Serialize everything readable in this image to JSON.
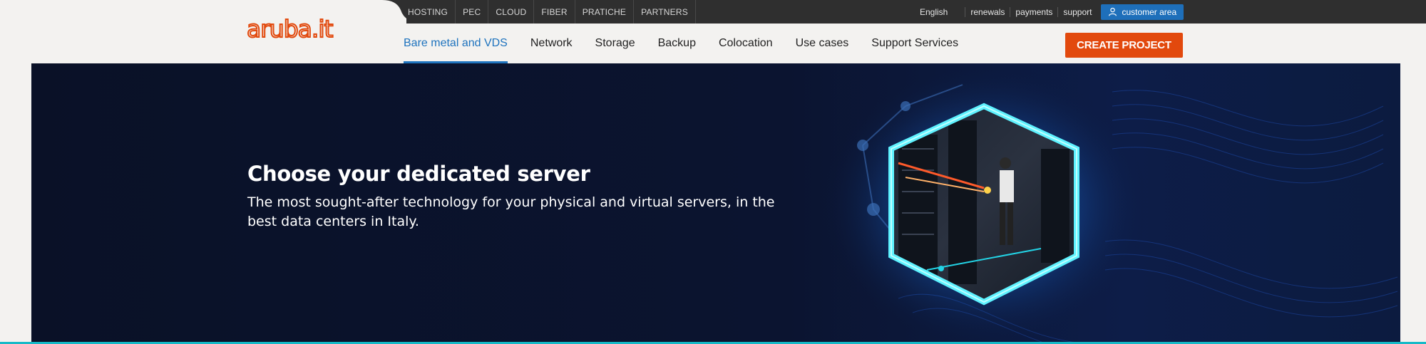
{
  "brand": {
    "logo_text": "aruba.it"
  },
  "topbar": {
    "links": [
      "HOSTING",
      "PEC",
      "CLOUD",
      "FIBER",
      "PRATICHE",
      "PARTNERS"
    ],
    "language": "English",
    "quick_links": [
      "renewals",
      "payments",
      "support"
    ],
    "customer_area": "customer area"
  },
  "mainnav": {
    "items": [
      "Bare metal and VDS",
      "Network",
      "Storage",
      "Backup",
      "Colocation",
      "Use cases",
      "Support Services"
    ],
    "active_index": 0,
    "create_project": "CREATE PROJECT"
  },
  "hero": {
    "title": "Choose your dedicated server",
    "subtitle": "The most sought-after technology for your physical and virtual servers, in the best data centers in Italy."
  },
  "colors": {
    "accent_blue": "#1e73be",
    "cta_orange": "#e2490d",
    "hero_bg": "#0a1127",
    "glow_cyan": "#16b9c7"
  }
}
